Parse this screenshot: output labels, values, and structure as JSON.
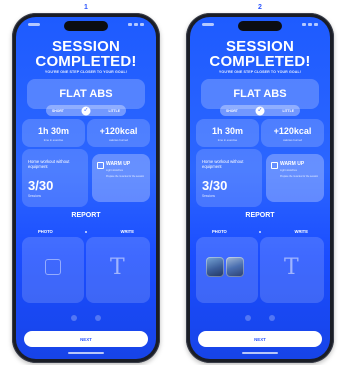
{
  "screens": [
    {
      "step": "1",
      "title_line1": "SESSION",
      "title_line2": "COMPLETED!",
      "subtitle": "YOU'RE ONE STEP CLOSER TO YOUR GOAL!",
      "workout_name": "FLAT ABS",
      "toggle_left": "SHORT",
      "toggle_right": "LITTLE",
      "toggle_icon": "✓",
      "stat_time": "1h 30m",
      "stat_time_sub": "time in exercise",
      "stat_kcal": "+120kcal",
      "stat_kcal_sub": "calories burned",
      "exercise_desc": "Home workout without equipment",
      "exercise_count": "3/30",
      "exercise_count_sub": "Sessions",
      "warmup_title": "WARM UP",
      "warmup_line1": "Light stretches",
      "warmup_line2": "Prepare the muscles for the session",
      "report": "REPORT",
      "tab_photo": "PHOTO",
      "tab_write": "WRITE",
      "next": "NEXT",
      "photo_attached": false
    },
    {
      "step": "2",
      "title_line1": "SESSION",
      "title_line2": "COMPLETED!",
      "subtitle": "YOU'RE ONE STEP CLOSER TO YOUR GOAL!",
      "workout_name": "FLAT ABS",
      "toggle_left": "SHORT",
      "toggle_right": "LITTLE",
      "toggle_icon": "✓",
      "stat_time": "1h 30m",
      "stat_time_sub": "time in exercise",
      "stat_kcal": "+120kcal",
      "stat_kcal_sub": "calories burned",
      "exercise_desc": "Home workout without equipment",
      "exercise_count": "3/30",
      "exercise_count_sub": "Sessions",
      "warmup_title": "WARM UP",
      "warmup_line1": "Light stretches",
      "warmup_line2": "Prepare the muscles for the session",
      "report": "REPORT",
      "tab_photo": "PHOTO",
      "tab_write": "WRITE",
      "next": "NEXT",
      "photo_attached": true
    }
  ],
  "colors": {
    "accent": "#2b55ff",
    "background": "#ffffff"
  }
}
